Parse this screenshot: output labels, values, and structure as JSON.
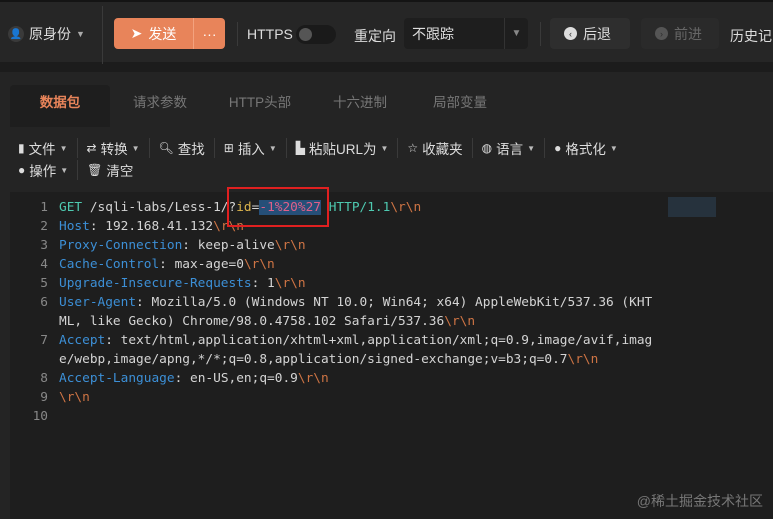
{
  "topbar": {
    "identity": "原身份",
    "send": "发送",
    "more": "···",
    "https_label": "HTTPS",
    "https_on": false,
    "redirect_label": "重定向",
    "redirect_value": "不跟踪",
    "back": "后退",
    "forward": "前进",
    "history": "历史记"
  },
  "tabs": [
    "数据包",
    "请求参数",
    "HTTP头部",
    "十六进制",
    "局部变量"
  ],
  "active_tab": "数据包",
  "toolbar": {
    "row1": [
      "文件",
      "转换",
      "查找",
      "插入",
      "粘贴URL为",
      "收藏夹",
      "语言",
      "格式化"
    ],
    "row2": [
      "操作",
      "清空"
    ]
  },
  "editor": {
    "line_numbers": [
      "1",
      "2",
      "3",
      "4",
      "5",
      "6",
      "",
      "7",
      "",
      "8",
      "9",
      "10"
    ],
    "l1": {
      "method": "GET",
      "path": " /sqli-labs/Less-1/?",
      "param": "id",
      "eq": "=",
      "value": "-1%20%27",
      "version": " HTTP/1.1"
    },
    "headers": [
      {
        "key": "Host",
        "value": "192.168.41.132"
      },
      {
        "key": "Proxy-Connection",
        "value": "keep-alive"
      },
      {
        "key": "Cache-Control",
        "value": "max-age=0"
      },
      {
        "key": "Upgrade-Insecure-Requests",
        "value": "1"
      },
      {
        "key": "User-Agent",
        "value": "Mozilla/5.0 (Windows NT 10.0; Win64; x64) AppleWebKit/537.36 (KHT",
        "cont": "ML, like Gecko) Chrome/98.0.4758.102 Safari/537.36"
      },
      {
        "key": "Accept",
        "value": "text/html,application/xhtml+xml,application/xml;q=0.9,image/avif,imag",
        "cont": "e/webp,image/apng,*/*;q=0.8,application/signed-exchange;v=b3;q=0.7"
      },
      {
        "key": "Accept-Language",
        "value": "en-US,en;q=0.9"
      }
    ],
    "crlf": "\\r\\n",
    "sep": ": "
  },
  "watermark": "@稀土掘金技术社区",
  "colors": {
    "accent": "#e8845a",
    "highlight_box": "#e02020"
  }
}
